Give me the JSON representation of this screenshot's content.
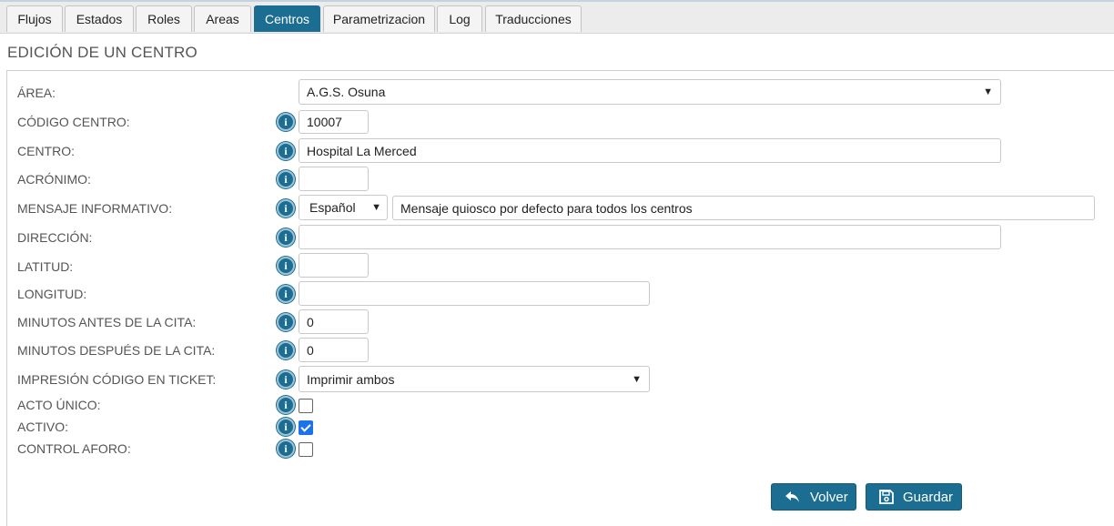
{
  "tabs": [
    {
      "label": "Flujos",
      "active": false
    },
    {
      "label": "Estados",
      "active": false
    },
    {
      "label": "Roles",
      "active": false
    },
    {
      "label": "Areas",
      "active": false
    },
    {
      "label": "Centros",
      "active": true
    },
    {
      "label": "Parametrizacion",
      "active": false
    },
    {
      "label": "Log",
      "active": false
    },
    {
      "label": "Traducciones",
      "active": false
    }
  ],
  "page_title": "EDICIÓN DE UN CENTRO",
  "form": {
    "area": {
      "label": "ÁREA:",
      "value": "A.G.S. Osuna"
    },
    "codigo_centro": {
      "label": "CÓDIGO CENTRO:",
      "value": "10007"
    },
    "centro": {
      "label": "CENTRO:",
      "value": "Hospital La Merced"
    },
    "acronimo": {
      "label": "ACRÓNIMO:",
      "value": ""
    },
    "mensaje_informativo": {
      "label": "MENSAJE INFORMATIVO:",
      "language": "Español",
      "value": "Mensaje quiosco por defecto para todos los centros"
    },
    "direccion": {
      "label": "DIRECCIÓN:",
      "value": ""
    },
    "latitud": {
      "label": "LATITUD:",
      "value": ""
    },
    "longitud": {
      "label": "LONGITUD:",
      "value": ""
    },
    "minutos_antes": {
      "label": "MINUTOS ANTES DE LA CITA:",
      "value": "0"
    },
    "minutos_despues": {
      "label": "MINUTOS DESPUÉS DE LA CITA:",
      "value": "0"
    },
    "impresion_codigo": {
      "label": "IMPRESIÓN CÓDIGO EN TICKET:",
      "value": "Imprimir ambos"
    },
    "acto_unico": {
      "label": "ACTO ÚNICO:",
      "checked": false
    },
    "activo": {
      "label": "ACTIVO:",
      "checked": true
    },
    "control_aforo": {
      "label": "CONTROL AFORO:",
      "checked": false
    }
  },
  "buttons": {
    "volver": "Volver",
    "guardar": "Guardar"
  },
  "icons": {
    "info": "info-icon",
    "back": "undo-arrow-icon",
    "save": "floppy-disk-icon",
    "dropdown": "chevron-down-icon"
  },
  "colors": {
    "accent": "#1b6d92",
    "checkbox_checked": "#1a73e8"
  }
}
